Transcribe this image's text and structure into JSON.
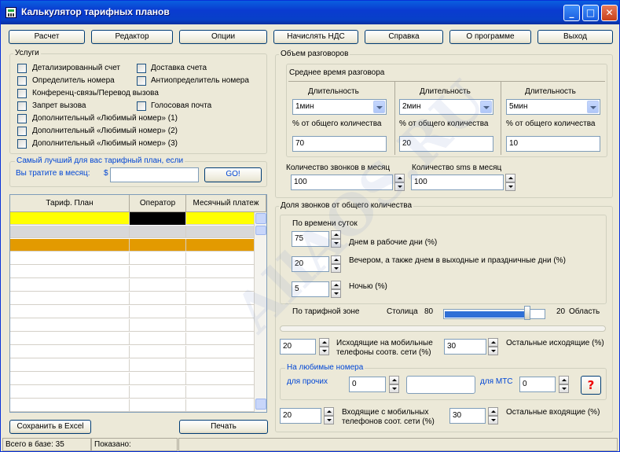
{
  "title": "Калькулятор тарифных планов",
  "toolbar": [
    "Расчет",
    "Редактор",
    "Опции",
    "Начислять НДС",
    "Справка",
    "О программе",
    "Выход"
  ],
  "services": {
    "title": "Услуги",
    "items": [
      "Детализированный счет",
      "Доставка счета",
      "Определитель номера",
      "Антиопределитель номера",
      "Конференц-связь/Перевод вызова",
      "Запрет вызова",
      "Голосовая почта",
      "Дополнительный «Любимый номер» (1)",
      "Дополнительный «Любимый номер» (2)",
      "Дополнительный «Любимый номер» (3)"
    ]
  },
  "best": {
    "title": "Самый лучший для вас тарифный план, если",
    "spend_label": "Вы тратите в месяц:",
    "currency": "$",
    "go": "GO!"
  },
  "table": {
    "headers": [
      "Тариф. План",
      "Оператор",
      "Месячный платеж"
    ]
  },
  "volume": {
    "title": "Объем разговоров",
    "avg_title": "Среднее время разговора",
    "duration_label": "Длительность",
    "percent_label": "% от общего количества",
    "durations": [
      "1мин",
      "2мин",
      "5мин"
    ],
    "percents": [
      "70",
      "20",
      "10"
    ],
    "calls_label": "Количество звонков в месяц",
    "calls": "100",
    "sms_label": "Количество sms в месяц",
    "sms": "100"
  },
  "share": {
    "title": "Доля звонков от общего количества",
    "time_title": "По времени суток",
    "day_label": "Днем в рабочие дни (%)",
    "day": "75",
    "evening_label": "Вечером, а также днем в выходные и праздничные дни (%)",
    "evening": "20",
    "night_label": "Ночью (%)",
    "night": "5",
    "zone_label": "По тарифной зоне",
    "capital_label": "Столица",
    "capital": "80",
    "region": "20",
    "region_label": "Область",
    "zone_level": 0.8
  },
  "mobile": {
    "out_mobile": "20",
    "out_mobile_label": "Исходящие на мобильные телефоны соотв. сети (%)",
    "out_other": "30",
    "out_other_label": "Остальные исходящие (%)",
    "fav_title": "На любимые номера",
    "fav_other_label": "для прочих",
    "fav_other": "0",
    "fav_mts_label": "для МТС",
    "fav_mts": "0",
    "help": "?",
    "in_mobile": "20",
    "in_mobile_label": "Входящие с мобильных телефонов соот. сети (%)",
    "in_other": "30",
    "in_other_label": "Остальные входящие (%)"
  },
  "bottom": {
    "save": "Сохранить в Excel",
    "print": "Печать"
  },
  "status": {
    "base": "Всего в базе: 35",
    "shown": "Показано:"
  },
  "watermark": "AllAOS.RU"
}
